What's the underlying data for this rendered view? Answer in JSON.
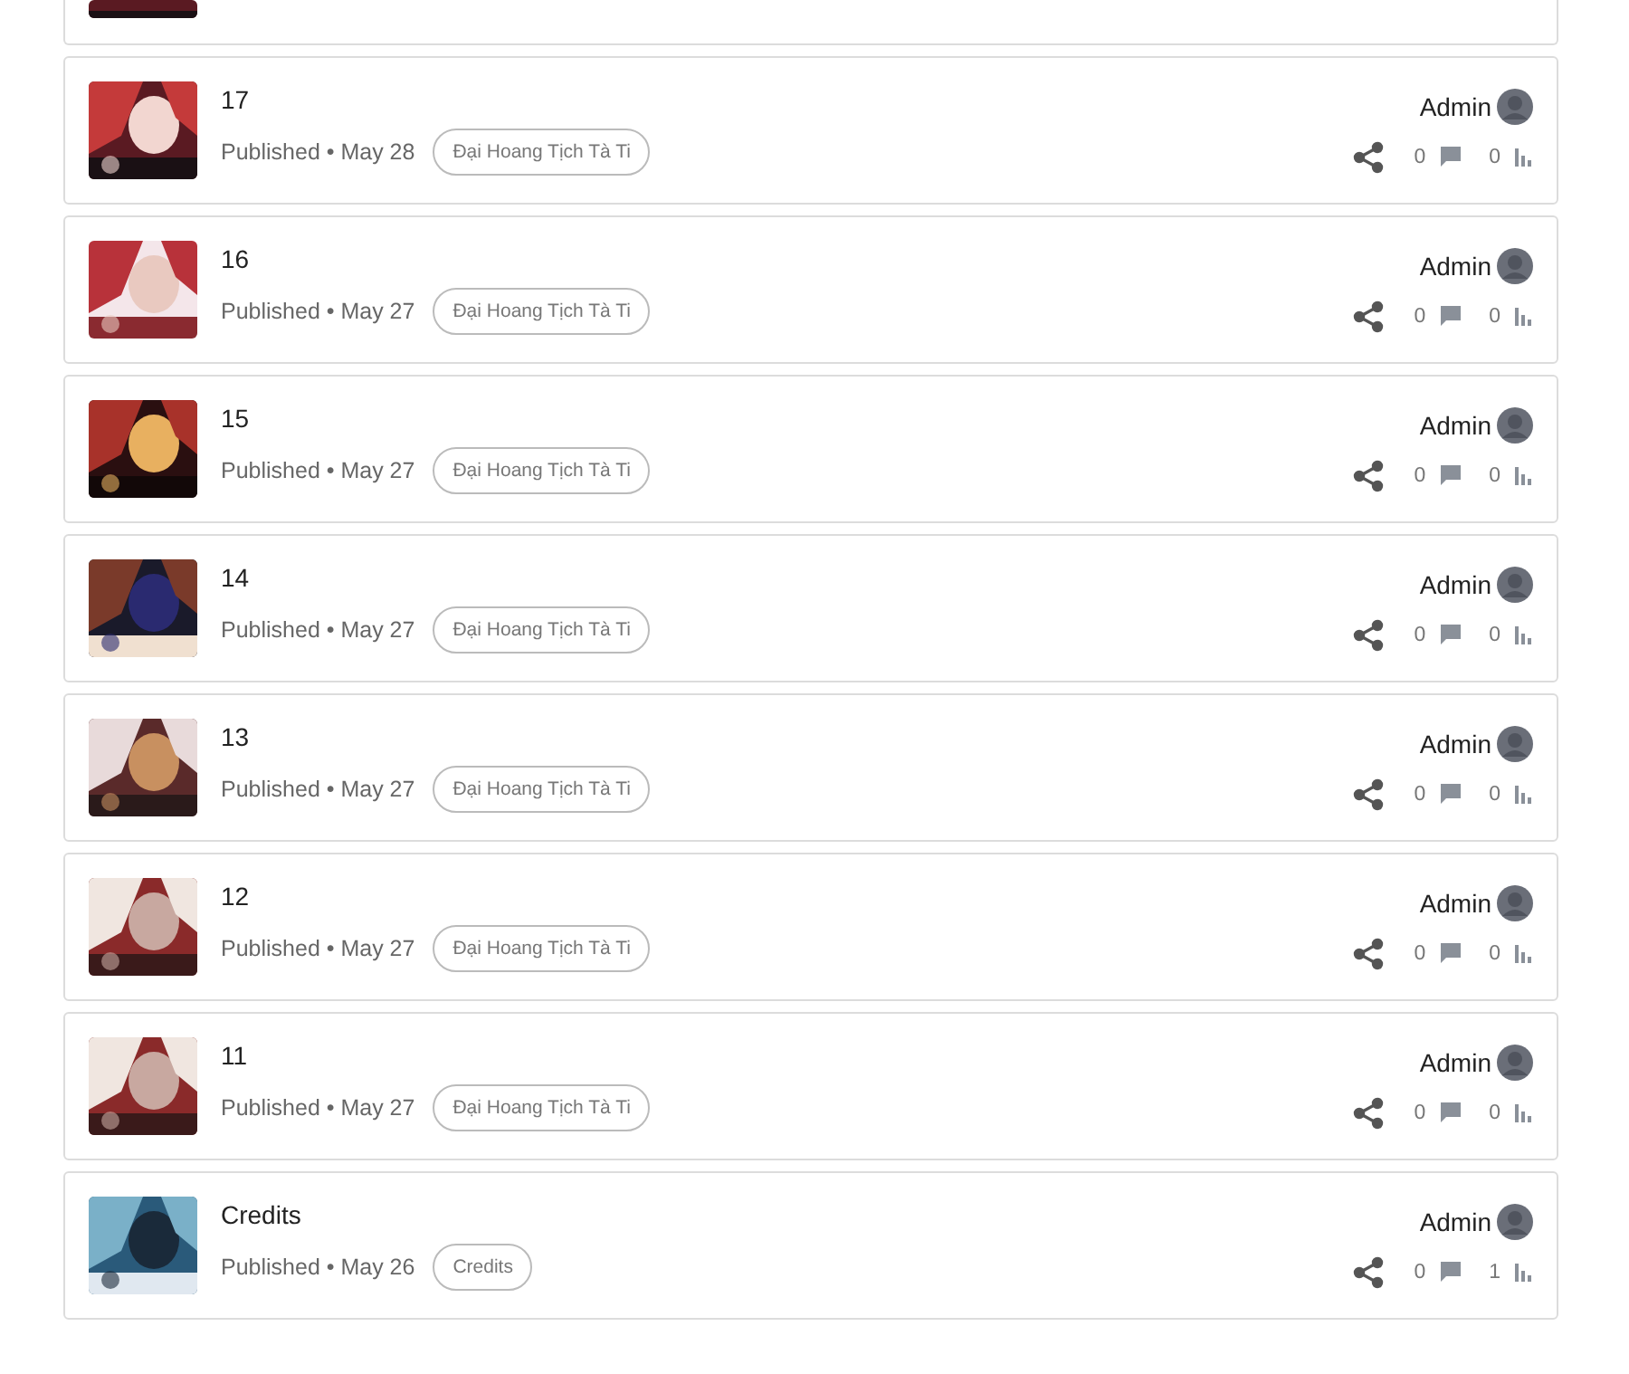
{
  "posts": [
    {
      "title": "17",
      "meta": "Published • May 28",
      "tag": "Đại Hoang Tịch Tà Ti",
      "author": "Admin",
      "comments": "0",
      "views": "0"
    },
    {
      "title": "16",
      "meta": "Published • May 27",
      "tag": "Đại Hoang Tịch Tà Ti",
      "author": "Admin",
      "comments": "0",
      "views": "0"
    },
    {
      "title": "15",
      "meta": "Published • May 27",
      "tag": "Đại Hoang Tịch Tà Ti",
      "author": "Admin",
      "comments": "0",
      "views": "0"
    },
    {
      "title": "14",
      "meta": "Published • May 27",
      "tag": "Đại Hoang Tịch Tà Ti",
      "author": "Admin",
      "comments": "0",
      "views": "0"
    },
    {
      "title": "13",
      "meta": "Published • May 27",
      "tag": "Đại Hoang Tịch Tà Ti",
      "author": "Admin",
      "comments": "0",
      "views": "0"
    },
    {
      "title": "12",
      "meta": "Published • May 27",
      "tag": "Đại Hoang Tịch Tà Ti",
      "author": "Admin",
      "comments": "0",
      "views": "0"
    },
    {
      "title": "11",
      "meta": "Published • May 27",
      "tag": "Đại Hoang Tịch Tà Ti",
      "author": "Admin",
      "comments": "0",
      "views": "0"
    },
    {
      "title": "Credits",
      "meta": "Published • May 26",
      "tag": "Credits",
      "author": "Admin",
      "comments": "0",
      "views": "1"
    }
  ]
}
